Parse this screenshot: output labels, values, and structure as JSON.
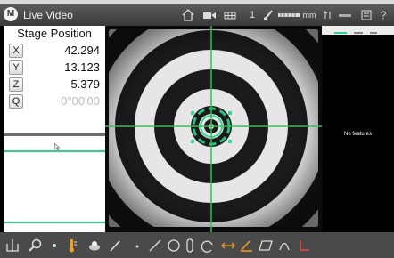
{
  "titlebar": {
    "app_title": "Live Video",
    "logo_glyph": "M",
    "icons": [
      "home-icon",
      "video-camera-icon",
      "grid-icon",
      "measure-count-icon",
      "magnification-icon",
      "units-icon",
      "readout-icon",
      "stats-icon",
      "settings-icon",
      "help-icon"
    ],
    "counter": "1",
    "units": "mm",
    "help": "?"
  },
  "stage": {
    "title": "Stage Position",
    "axes": [
      {
        "label": "X",
        "value": "42.294"
      },
      {
        "label": "Y",
        "value": "13.123"
      },
      {
        "label": "Z",
        "value": "5.379"
      },
      {
        "label": "Q",
        "value": "0°00'00"
      }
    ]
  },
  "right_panel": {
    "empty_message": "No features"
  },
  "toolbar": {
    "tools": [
      "crosshair-tool-icon",
      "zoom-tool-icon",
      "probe-point-icon",
      "light-icon",
      "camera-icon",
      "line-draw-icon",
      "point-icon",
      "line-icon",
      "circle-icon",
      "slot-icon",
      "arc-icon",
      "distance-icon",
      "angle-icon",
      "rectangle-icon",
      "curve-icon",
      "perpendicular-icon"
    ]
  },
  "colors": {
    "crosshair": "#2ec05a",
    "measure_lines": "#2fd08a",
    "titlebar": "#4a4a4a",
    "toolbar": "#4a4a4a"
  }
}
